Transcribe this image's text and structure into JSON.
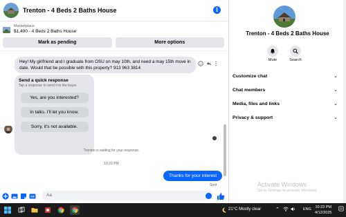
{
  "conversation": {
    "title": "Trenton - 4 Beds 2 Baths House"
  },
  "marketplace": {
    "label": "Marketplace",
    "listing": "$1,400 - 4 Beds 2 Baths House",
    "mark_pending": "Mark as pending",
    "more_options": "More options"
  },
  "messages": {
    "incoming": "Hey! My girlfriend and I graduate from OSU on may 10th, and need a may 15th move in date. Would that be possible with this property? 913 963 3814",
    "quick_response_title": "Send a quick response",
    "quick_response_subtitle": "Tap a response to send it to the buyer.",
    "quick_responses": [
      "Yes, are you interested?",
      "In talks. I'll let you know.",
      "Sorry, it's not available."
    ],
    "waiting_notice": "Trenton is waiting for your response.",
    "timestamp": "10:23 PM",
    "outgoing": "Thanks for your interest",
    "status": "Sent"
  },
  "composer": {
    "placeholder": "Aa"
  },
  "details": {
    "name": "Trenton - 4 Beds 2 Baths House",
    "mute_label": "Mute",
    "search_label": "Search",
    "sections": [
      "Customize chat",
      "Chat members",
      "Media, files and links",
      "Privacy & support"
    ]
  },
  "watermark": {
    "title": "Activate Windows",
    "subtitle": "Go to Settings to activate Windows."
  },
  "taskbar": {
    "weather": "21°C  Mostly clear",
    "language": "ENG",
    "time": "10:23 PM",
    "date": "4/12/2025"
  },
  "colors": {
    "accent": "#0866ff",
    "bubble_in": "#e4e6eb",
    "taskbar": "#1b1b1b"
  }
}
